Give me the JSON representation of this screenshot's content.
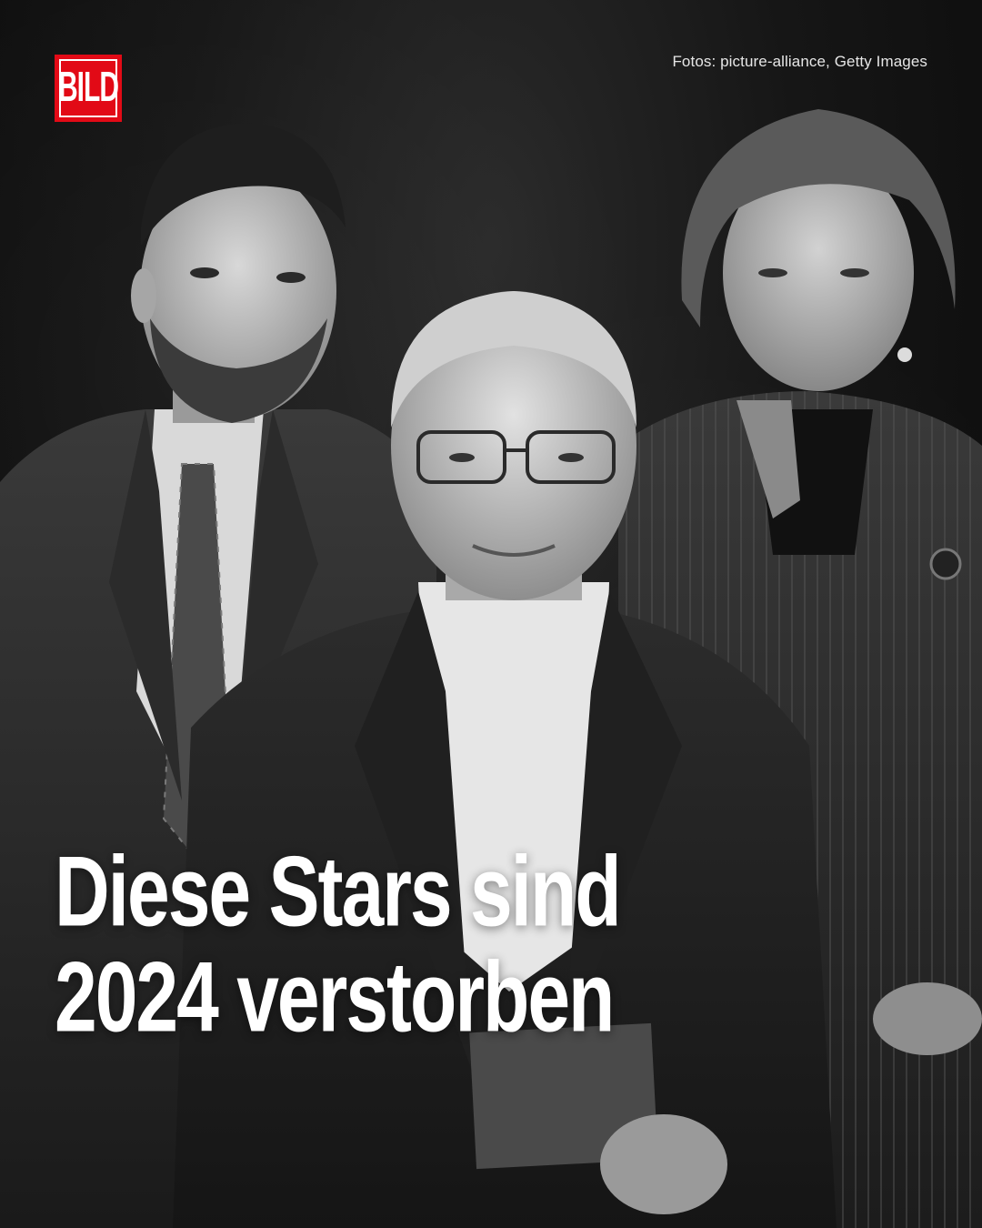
{
  "brand": {
    "logo_text": "BILD",
    "logo_color": "#e20a16"
  },
  "credit": "Fotos: picture-alliance, Getty Images",
  "headline": {
    "line1": "Diese Stars sind",
    "line2": "2024 verstorben"
  },
  "palette": {
    "background": "#0b0b0b",
    "text": "#ffffff"
  }
}
